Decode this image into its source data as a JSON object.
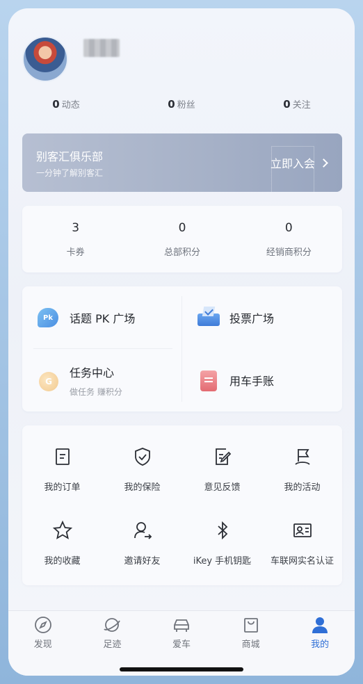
{
  "profile": {
    "username": "",
    "stats": [
      {
        "value": "0",
        "label": "动态"
      },
      {
        "value": "0",
        "label": "粉丝"
      },
      {
        "value": "0",
        "label": "关注"
      }
    ]
  },
  "club": {
    "title": "别客汇俱乐部",
    "subtitle": "一分钟了解别客汇",
    "join_label": "立即入会"
  },
  "points": [
    {
      "value": "3",
      "label": "卡券"
    },
    {
      "value": "0",
      "label": "总部积分"
    },
    {
      "value": "0",
      "label": "经销商积分"
    }
  ],
  "plaza": {
    "items": [
      {
        "title": "话题 PK 广场",
        "subtitle": "",
        "icon": "pk-icon",
        "icon_text": "Pk"
      },
      {
        "title": "投票广场",
        "subtitle": "",
        "icon": "vote-icon"
      },
      {
        "title": "任务中心",
        "subtitle": "做任务 赚积分",
        "icon": "task-icon",
        "icon_text": "G"
      },
      {
        "title": "用车手账",
        "subtitle": "",
        "icon": "car-notebook-icon"
      }
    ]
  },
  "services": [
    {
      "label": "我的订单",
      "icon": "order-icon"
    },
    {
      "label": "我的保险",
      "icon": "insurance-shield-icon"
    },
    {
      "label": "意见反馈",
      "icon": "feedback-icon"
    },
    {
      "label": "我的活动",
      "icon": "activity-flag-icon"
    },
    {
      "label": "我的收藏",
      "icon": "star-icon"
    },
    {
      "label": "邀请好友",
      "icon": "invite-user-icon"
    },
    {
      "label": "iKey 手机钥匙",
      "icon": "bluetooth-icon"
    },
    {
      "label": "车联网实名认证",
      "icon": "id-card-icon"
    }
  ],
  "tabs": [
    {
      "label": "发现",
      "icon": "compass-icon",
      "active": false
    },
    {
      "label": "足迹",
      "icon": "planet-icon",
      "active": false
    },
    {
      "label": "爱车",
      "icon": "car-icon",
      "active": false
    },
    {
      "label": "商城",
      "icon": "shopping-bag-icon",
      "active": false
    },
    {
      "label": "我的",
      "icon": "user-icon",
      "active": true
    }
  ],
  "colors": {
    "accent": "#2f6fd6",
    "club_banner": "#a7b2c8",
    "text_primary": "#24272d",
    "text_secondary": "#6d727c"
  }
}
